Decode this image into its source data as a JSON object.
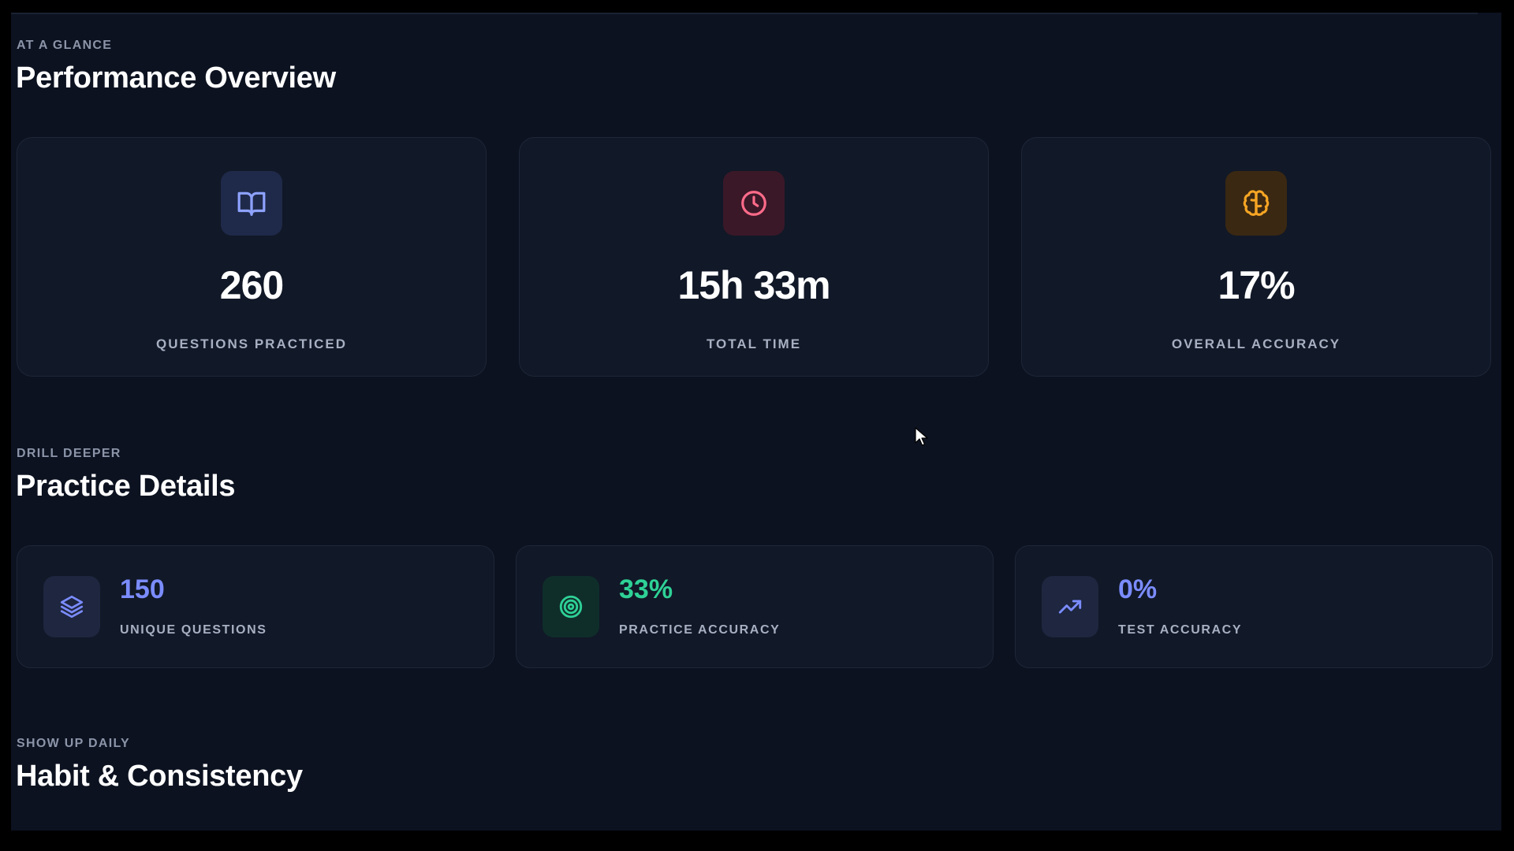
{
  "overview": {
    "eyebrow": "AT A GLANCE",
    "title": "Performance Overview",
    "cards": [
      {
        "icon": "book-open-icon",
        "value": "260",
        "label": "QUESTIONS PRACTICED",
        "accent": "#8ea2ff",
        "icon_bg": "#1f2a4a"
      },
      {
        "icon": "clock-icon",
        "value": "15h 33m",
        "label": "TOTAL TIME",
        "accent": "#ff6b8a",
        "icon_bg": "#3a1828"
      },
      {
        "icon": "brain-icon",
        "value": "17%",
        "label": "OVERALL ACCURACY",
        "accent": "#f5a524",
        "icon_bg": "#3a2812"
      }
    ]
  },
  "practice": {
    "eyebrow": "DRILL DEEPER",
    "title": "Practice Details",
    "cards": [
      {
        "icon": "layers-icon",
        "value": "150",
        "label": "UNIQUE QUESTIONS",
        "accent": "#7b8cff",
        "icon_bg": "#1e2640"
      },
      {
        "icon": "target-icon",
        "value": "33%",
        "label": "PRACTICE ACCURACY",
        "accent": "#2ed196",
        "icon_bg": "#0f2e2a"
      },
      {
        "icon": "trending-up-icon",
        "value": "0%",
        "label": "TEST ACCURACY",
        "accent": "#7b8cff",
        "icon_bg": "#1e2640"
      }
    ]
  },
  "habit": {
    "eyebrow": "SHOW UP DAILY",
    "title": "Habit & Consistency"
  },
  "colors": {
    "background": "#0c1220",
    "card": "#111827",
    "heading": "#ffffff",
    "muted": "#8b94a8"
  }
}
